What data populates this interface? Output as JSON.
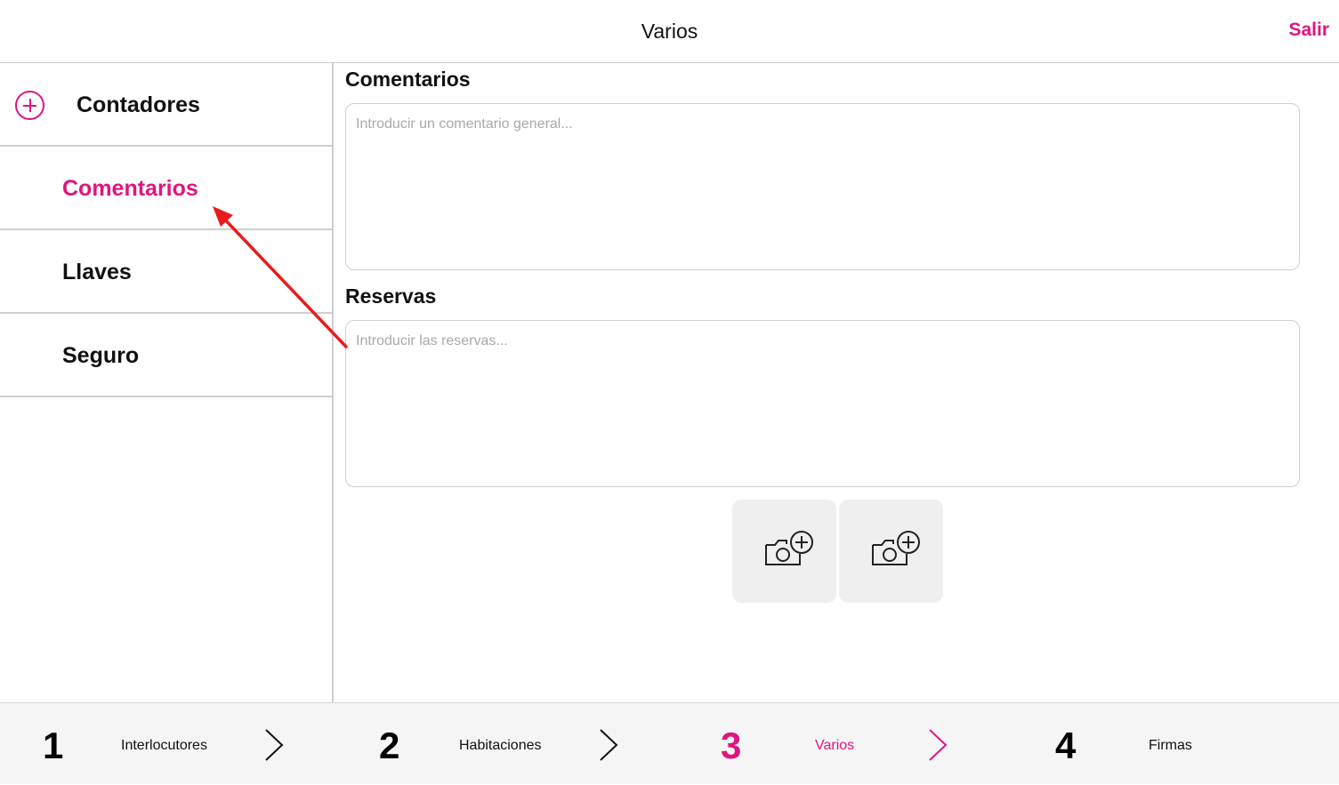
{
  "header": {
    "title": "Varios",
    "exit_label": "Salir"
  },
  "sidebar": {
    "items": [
      {
        "label": "Contadores",
        "icon": "plus-circle-icon"
      },
      {
        "label": "Comentarios",
        "active": true
      },
      {
        "label": "Llaves"
      },
      {
        "label": "Seguro"
      }
    ]
  },
  "main": {
    "comments": {
      "title": "Comentarios",
      "placeholder": "Introducir un comentario general...",
      "value": ""
    },
    "reservations": {
      "title": "Reservas",
      "placeholder": "Introducir las reservas...",
      "value": ""
    },
    "photo_buttons": [
      {
        "icon": "add-photo-camera-icon"
      },
      {
        "icon": "add-photo-camera-icon"
      }
    ]
  },
  "steps": [
    {
      "number": "1",
      "label": "Interlocutores"
    },
    {
      "number": "2",
      "label": "Habitaciones"
    },
    {
      "number": "3",
      "label": "Varios",
      "active": true
    },
    {
      "number": "4",
      "label": "Firmas"
    }
  ],
  "colors": {
    "accent": "#e0147f",
    "annotation": "#e81b1b",
    "divider": "#cfcfcf",
    "photo_button_bg": "#efefef"
  }
}
